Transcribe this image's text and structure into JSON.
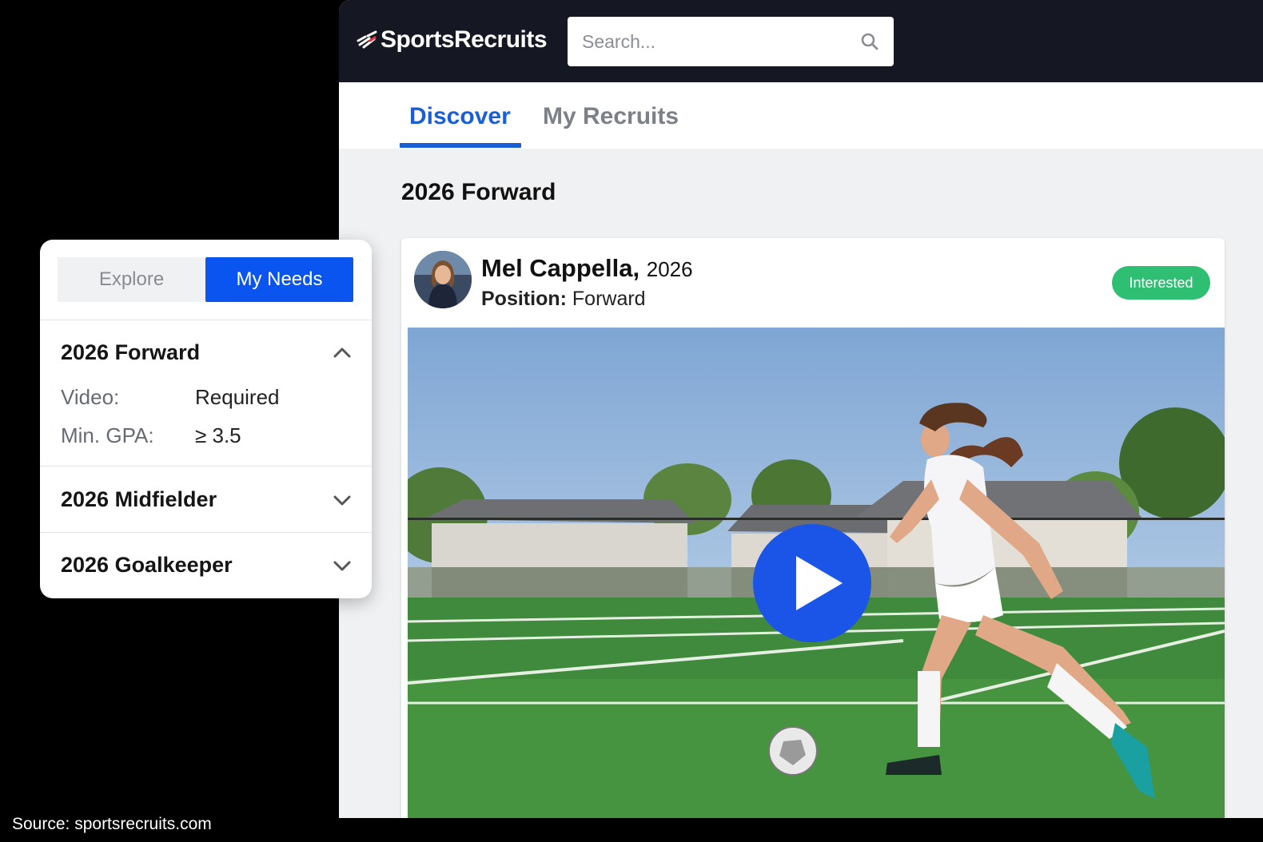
{
  "header": {
    "logo_text": "SportsRecruits",
    "search_placeholder": "Search..."
  },
  "tabs": [
    {
      "label": "Discover",
      "active": true
    },
    {
      "label": "My Recruits",
      "active": false
    }
  ],
  "main": {
    "section_title": "2026 Forward",
    "athlete": {
      "name": "Mel Cappella,",
      "year": "2026",
      "position_label": "Position:",
      "position_value": "Forward",
      "status": "Interested"
    }
  },
  "panel": {
    "segments": [
      {
        "label": "Explore",
        "active": false
      },
      {
        "label": "My Needs",
        "active": true
      }
    ],
    "needs": [
      {
        "title": "2026 Forward",
        "expanded": true,
        "requirements": [
          {
            "label": "Video:",
            "value": "Required"
          },
          {
            "label": "Min. GPA:",
            "value": "≥ 3.5"
          }
        ]
      },
      {
        "title": "2026 Midfielder",
        "expanded": false
      },
      {
        "title": "2026 Goalkeeper",
        "expanded": false
      }
    ]
  },
  "source_caption": "Source:  sportsrecruits.com",
  "colors": {
    "brand_blue": "#1b5fd6",
    "play_blue": "#1a55e8",
    "status_green": "#2ebf73",
    "topbar_dark": "#151722"
  },
  "icons": [
    "logo-mark-icon",
    "search-icon",
    "chevron-up-icon",
    "chevron-down-icon",
    "play-icon"
  ]
}
